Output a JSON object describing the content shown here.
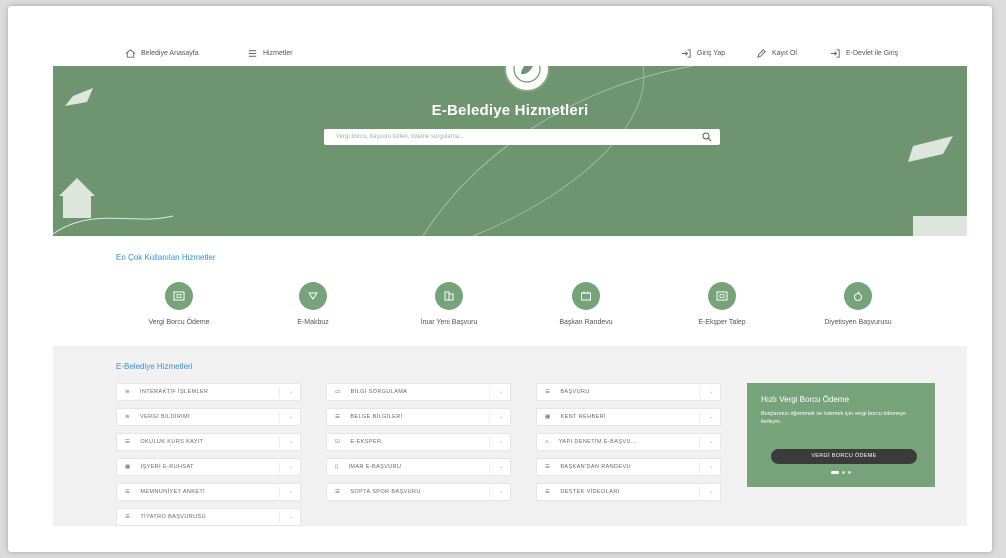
{
  "nav": {
    "home_label": "Belediye Anasayfa",
    "services_label": "Hizmetler",
    "login_label": "Giriş Yap",
    "register_label": "Kayıt Ol",
    "edevlet_label": "E-Devlet ile Giriş"
  },
  "hero": {
    "title": "E-Belediye Hizmetleri",
    "search_placeholder": "Vergi borcu, başvuru türleri, ödeme sorgulama..."
  },
  "most_used": {
    "title": "En Çok Kullanılan Hizmetler",
    "items": [
      {
        "label": "Vergi Borcu Ödeme",
        "icon": "payment-icon"
      },
      {
        "label": "E-Makbuz",
        "icon": "receipt-icon"
      },
      {
        "label": "İmar Yeni Başvuru",
        "icon": "building-icon"
      },
      {
        "label": "Başkan Randevu",
        "icon": "calendar-icon"
      },
      {
        "label": "E-Ekşper Talep",
        "icon": "document-icon"
      },
      {
        "label": "Diyetisyen Başvurusu",
        "icon": "apple-icon"
      }
    ]
  },
  "services": {
    "title": "E-Belediye Hizmetleri",
    "col1": [
      "İNTERAKTİF İŞLEMLER",
      "VERGİ BİLDİRİMİ",
      "OKULUK KURS KAYIT",
      "İŞYERİ E-RUHSAT",
      "MEMNUNİYET ANKETİ",
      "TİYATRO BAŞVURUSU"
    ],
    "col2": [
      "BİLGİ SORGULAMA",
      "BELGE BİLGİLERİ",
      "E-EKSPER",
      "İMAR E-BAŞVURU",
      "SOPTA SPOR BAŞVURU"
    ],
    "col3": [
      "BAŞVURU",
      "KENT REHBERİ",
      "YAPI DENETİM E-BAŞVU...",
      "BAŞKAN'DAN RANDEVU",
      "DESTEK VİDEOLARI"
    ]
  },
  "promo": {
    "title": "Hızlı Vergi Borcu Ödeme",
    "text": "Borçlarınızı öğrenmek ve ödemek için vergi borcu ödemeye ilerleyin.",
    "button": "VERGİ BORCU ÖDEME"
  },
  "colors": {
    "accent": "#6e9570",
    "link": "#3a8fd8"
  }
}
